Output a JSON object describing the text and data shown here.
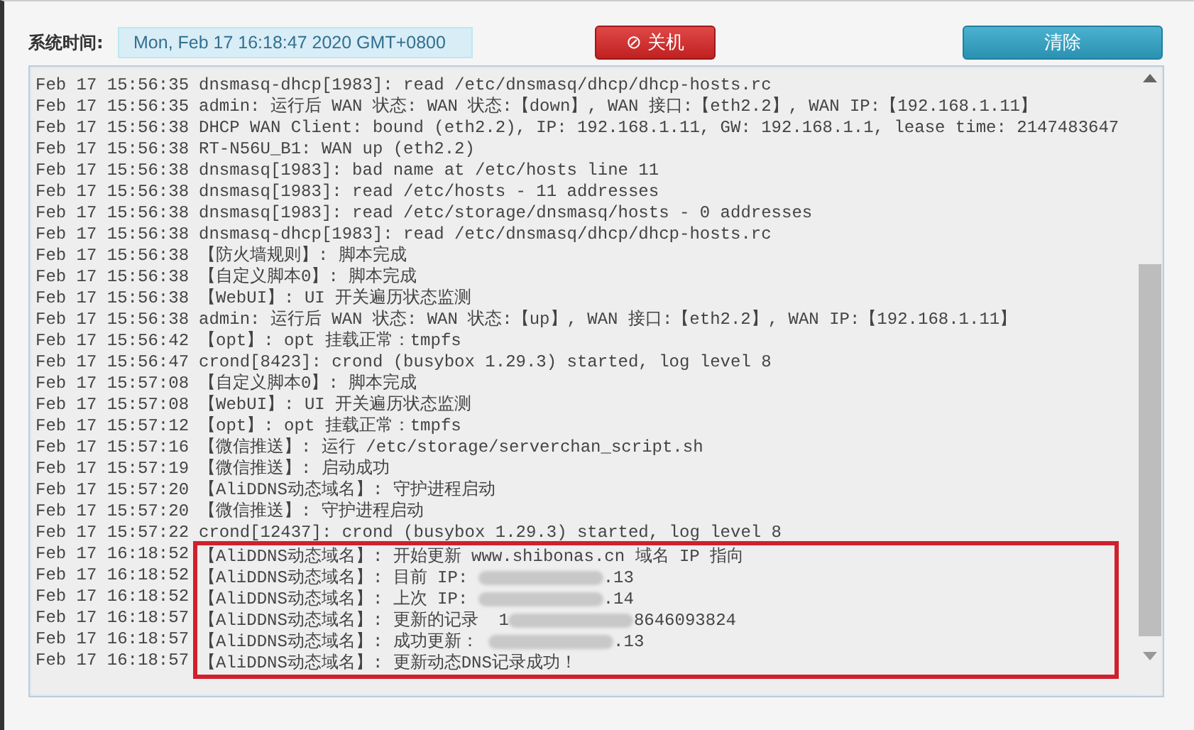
{
  "toolbar": {
    "time_label": "系统时间:",
    "time_value": "Mon, Feb 17 16:18:47 2020 GMT+0800",
    "shutdown_button": {
      "icon": "⊘",
      "label": "关机"
    },
    "clear_button": "清除"
  },
  "log": {
    "lines": [
      {
        "time": "Feb 17 15:56:35",
        "message": "dnsmasq-dhcp[1983]: read /etc/dnsmasq/dhcp/dhcp-hosts.rc",
        "highlighted": false
      },
      {
        "time": "Feb 17 15:56:35",
        "message": "admin: 运行后 WAN 状态: WAN 状态:【down】, WAN 接口:【eth2.2】, WAN IP:【192.168.1.11】",
        "highlighted": false
      },
      {
        "time": "Feb 17 15:56:38",
        "message": "DHCP WAN Client: bound (eth2.2), IP: 192.168.1.11, GW: 192.168.1.1, lease time: 2147483647",
        "highlighted": false
      },
      {
        "time": "Feb 17 15:56:38",
        "message": "RT-N56U_B1: WAN up (eth2.2)",
        "highlighted": false
      },
      {
        "time": "Feb 17 15:56:38",
        "message": "dnsmasq[1983]: bad name at /etc/hosts line 11",
        "highlighted": false
      },
      {
        "time": "Feb 17 15:56:38",
        "message": "dnsmasq[1983]: read /etc/hosts - 11 addresses",
        "highlighted": false
      },
      {
        "time": "Feb 17 15:56:38",
        "message": "dnsmasq[1983]: read /etc/storage/dnsmasq/hosts - 0 addresses",
        "highlighted": false
      },
      {
        "time": "Feb 17 15:56:38",
        "message": "dnsmasq-dhcp[1983]: read /etc/dnsmasq/dhcp/dhcp-hosts.rc",
        "highlighted": false
      },
      {
        "time": "Feb 17 15:56:38",
        "message": "【防火墙规则】: 脚本完成",
        "highlighted": false
      },
      {
        "time": "Feb 17 15:56:38",
        "message": "【自定义脚本0】: 脚本完成",
        "highlighted": false
      },
      {
        "time": "Feb 17 15:56:38",
        "message": "【WebUI】: UI 开关遍历状态监测",
        "highlighted": false
      },
      {
        "time": "Feb 17 15:56:38",
        "message": "admin: 运行后 WAN 状态: WAN 状态:【up】, WAN 接口:【eth2.2】, WAN IP:【192.168.1.11】",
        "highlighted": false
      },
      {
        "time": "Feb 17 15:56:42",
        "message": "【opt】: opt 挂载正常：tmpfs",
        "highlighted": false
      },
      {
        "time": "Feb 17 15:56:47",
        "message": "crond[8423]: crond (busybox 1.29.3) started, log level 8",
        "highlighted": false
      },
      {
        "time": "Feb 17 15:57:08",
        "message": "【自定义脚本0】: 脚本完成",
        "highlighted": false
      },
      {
        "time": "Feb 17 15:57:08",
        "message": "【WebUI】: UI 开关遍历状态监测",
        "highlighted": false
      },
      {
        "time": "Feb 17 15:57:12",
        "message": "【opt】: opt 挂载正常：tmpfs",
        "highlighted": false
      },
      {
        "time": "Feb 17 15:57:16",
        "message": "【微信推送】: 运行 /etc/storage/serverchan_script.sh",
        "highlighted": false
      },
      {
        "time": "Feb 17 15:57:19",
        "message": "【微信推送】: 启动成功",
        "highlighted": false
      },
      {
        "time": "Feb 17 15:57:20",
        "message": "【AliDDNS动态域名】: 守护进程启动",
        "highlighted": false
      },
      {
        "time": "Feb 17 15:57:20",
        "message": "【微信推送】: 守护进程启动",
        "highlighted": false
      },
      {
        "time": "Feb 17 15:57:22",
        "message": "crond[12437]: crond (busybox 1.29.3) started, log level 8",
        "highlighted": false
      },
      {
        "time": "Feb 17 16:18:52",
        "message": "【AliDDNS动态域名】: 开始更新 www.shibonas.cn 域名 IP 指向",
        "highlighted": true
      },
      {
        "time": "Feb 17 16:18:52",
        "message": "【AliDDNS动态域名】: 目前 IP: ",
        "masked_tail": ".13",
        "highlighted": true
      },
      {
        "time": "Feb 17 16:18:52",
        "message": "【AliDDNS动态域名】: 上次 IP: ",
        "masked_tail": ".14",
        "highlighted": true
      },
      {
        "time": "Feb 17 16:18:57",
        "message": "【AliDDNS动态域名】: 更新的记录  1",
        "masked_tail": "8646093824",
        "highlighted": true
      },
      {
        "time": "Feb 17 16:18:57",
        "message": "【AliDDNS动态域名】: 成功更新： ",
        "masked_tail": ".13",
        "highlighted": true
      },
      {
        "time": "Feb 17 16:18:57",
        "message": "【AliDDNS动态域名】: 更新动态DNS记录成功！",
        "highlighted": true
      }
    ]
  }
}
